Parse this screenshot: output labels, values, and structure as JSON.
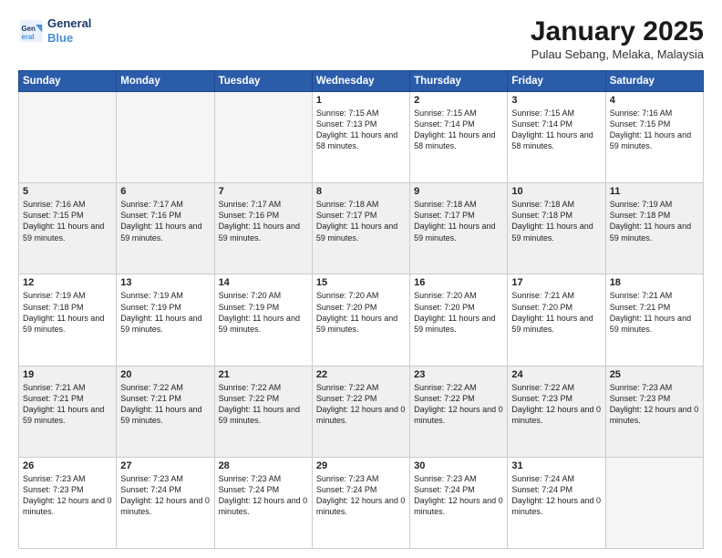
{
  "header": {
    "logo_line1": "General",
    "logo_line2": "Blue",
    "month": "January 2025",
    "location": "Pulau Sebang, Melaka, Malaysia"
  },
  "days_of_week": [
    "Sunday",
    "Monday",
    "Tuesday",
    "Wednesday",
    "Thursday",
    "Friday",
    "Saturday"
  ],
  "weeks": [
    [
      {
        "day": "",
        "empty": true
      },
      {
        "day": "",
        "empty": true
      },
      {
        "day": "",
        "empty": true
      },
      {
        "day": "1",
        "sunrise": "7:15 AM",
        "sunset": "7:13 PM",
        "daylight": "11 hours and 58 minutes."
      },
      {
        "day": "2",
        "sunrise": "7:15 AM",
        "sunset": "7:14 PM",
        "daylight": "11 hours and 58 minutes."
      },
      {
        "day": "3",
        "sunrise": "7:15 AM",
        "sunset": "7:14 PM",
        "daylight": "11 hours and 58 minutes."
      },
      {
        "day": "4",
        "sunrise": "7:16 AM",
        "sunset": "7:15 PM",
        "daylight": "11 hours and 59 minutes."
      }
    ],
    [
      {
        "day": "5",
        "sunrise": "7:16 AM",
        "sunset": "7:15 PM",
        "daylight": "11 hours and 59 minutes."
      },
      {
        "day": "6",
        "sunrise": "7:17 AM",
        "sunset": "7:16 PM",
        "daylight": "11 hours and 59 minutes."
      },
      {
        "day": "7",
        "sunrise": "7:17 AM",
        "sunset": "7:16 PM",
        "daylight": "11 hours and 59 minutes."
      },
      {
        "day": "8",
        "sunrise": "7:18 AM",
        "sunset": "7:17 PM",
        "daylight": "11 hours and 59 minutes."
      },
      {
        "day": "9",
        "sunrise": "7:18 AM",
        "sunset": "7:17 PM",
        "daylight": "11 hours and 59 minutes."
      },
      {
        "day": "10",
        "sunrise": "7:18 AM",
        "sunset": "7:18 PM",
        "daylight": "11 hours and 59 minutes."
      },
      {
        "day": "11",
        "sunrise": "7:19 AM",
        "sunset": "7:18 PM",
        "daylight": "11 hours and 59 minutes."
      }
    ],
    [
      {
        "day": "12",
        "sunrise": "7:19 AM",
        "sunset": "7:18 PM",
        "daylight": "11 hours and 59 minutes."
      },
      {
        "day": "13",
        "sunrise": "7:19 AM",
        "sunset": "7:19 PM",
        "daylight": "11 hours and 59 minutes."
      },
      {
        "day": "14",
        "sunrise": "7:20 AM",
        "sunset": "7:19 PM",
        "daylight": "11 hours and 59 minutes."
      },
      {
        "day": "15",
        "sunrise": "7:20 AM",
        "sunset": "7:20 PM",
        "daylight": "11 hours and 59 minutes."
      },
      {
        "day": "16",
        "sunrise": "7:20 AM",
        "sunset": "7:20 PM",
        "daylight": "11 hours and 59 minutes."
      },
      {
        "day": "17",
        "sunrise": "7:21 AM",
        "sunset": "7:20 PM",
        "daylight": "11 hours and 59 minutes."
      },
      {
        "day": "18",
        "sunrise": "7:21 AM",
        "sunset": "7:21 PM",
        "daylight": "11 hours and 59 minutes."
      }
    ],
    [
      {
        "day": "19",
        "sunrise": "7:21 AM",
        "sunset": "7:21 PM",
        "daylight": "11 hours and 59 minutes."
      },
      {
        "day": "20",
        "sunrise": "7:22 AM",
        "sunset": "7:21 PM",
        "daylight": "11 hours and 59 minutes."
      },
      {
        "day": "21",
        "sunrise": "7:22 AM",
        "sunset": "7:22 PM",
        "daylight": "11 hours and 59 minutes."
      },
      {
        "day": "22",
        "sunrise": "7:22 AM",
        "sunset": "7:22 PM",
        "daylight": "12 hours and 0 minutes."
      },
      {
        "day": "23",
        "sunrise": "7:22 AM",
        "sunset": "7:22 PM",
        "daylight": "12 hours and 0 minutes."
      },
      {
        "day": "24",
        "sunrise": "7:22 AM",
        "sunset": "7:23 PM",
        "daylight": "12 hours and 0 minutes."
      },
      {
        "day": "25",
        "sunrise": "7:23 AM",
        "sunset": "7:23 PM",
        "daylight": "12 hours and 0 minutes."
      }
    ],
    [
      {
        "day": "26",
        "sunrise": "7:23 AM",
        "sunset": "7:23 PM",
        "daylight": "12 hours and 0 minutes."
      },
      {
        "day": "27",
        "sunrise": "7:23 AM",
        "sunset": "7:24 PM",
        "daylight": "12 hours and 0 minutes."
      },
      {
        "day": "28",
        "sunrise": "7:23 AM",
        "sunset": "7:24 PM",
        "daylight": "12 hours and 0 minutes."
      },
      {
        "day": "29",
        "sunrise": "7:23 AM",
        "sunset": "7:24 PM",
        "daylight": "12 hours and 0 minutes."
      },
      {
        "day": "30",
        "sunrise": "7:23 AM",
        "sunset": "7:24 PM",
        "daylight": "12 hours and 0 minutes."
      },
      {
        "day": "31",
        "sunrise": "7:24 AM",
        "sunset": "7:24 PM",
        "daylight": "12 hours and 0 minutes."
      },
      {
        "day": "",
        "empty": true
      }
    ]
  ]
}
